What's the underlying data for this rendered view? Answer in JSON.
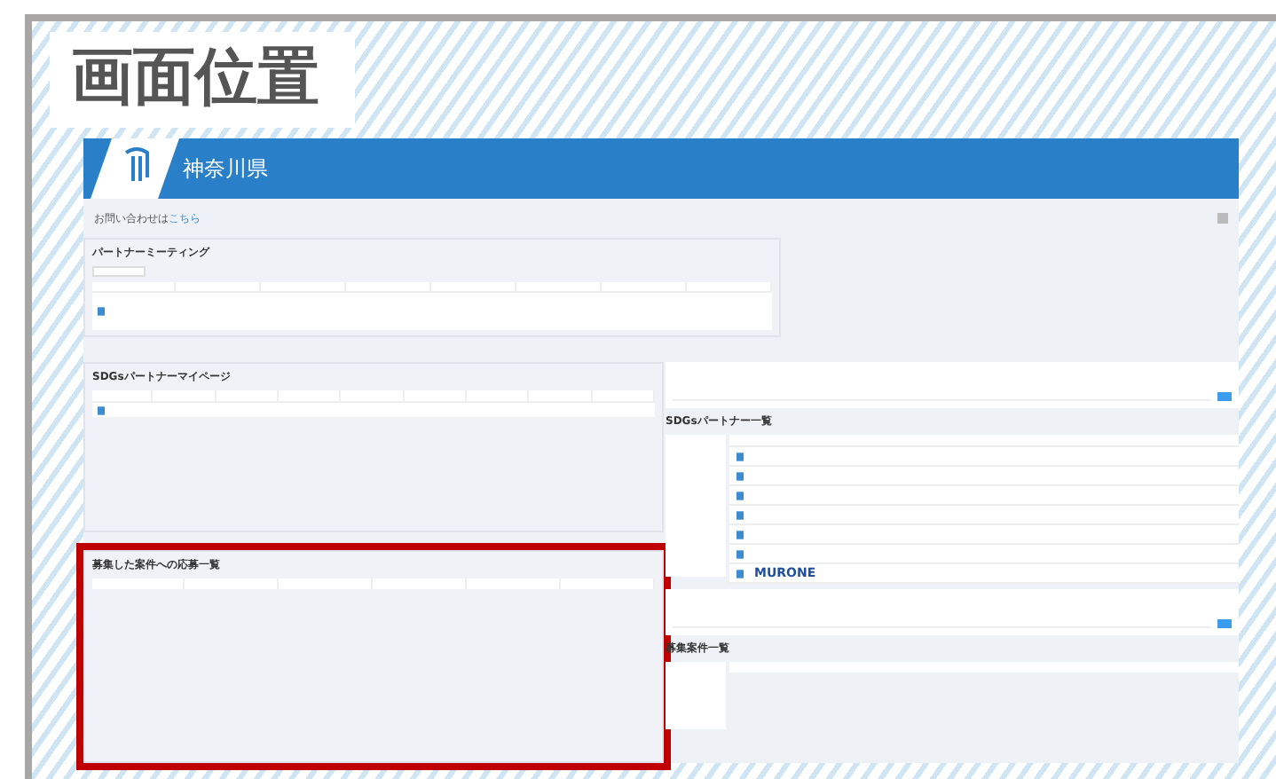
{
  "slide_title": "画面位置",
  "header": {
    "title": "神奈川県"
  },
  "contact": {
    "text": "お問い合わせは",
    "link": "こちら"
  },
  "panels": [
    {
      "kind": "meeting",
      "title": "パートナーミーティング",
      "highlighted": false
    },
    {
      "kind": "mypage",
      "title": "SDGsパートナーマイページ",
      "highlighted": false
    },
    {
      "kind": "applications",
      "title": "募集した案件への応募一覧",
      "highlighted": true
    }
  ],
  "partner_list": {
    "title": "SDGsパートナー一覧",
    "logo_text": "MURONE"
  },
  "recruit_list": {
    "title": "募集案件一覧"
  }
}
